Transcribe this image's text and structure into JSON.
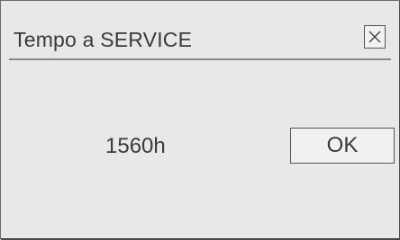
{
  "dialog": {
    "title": "Tempo a SERVICE",
    "close_icon": "close-icon",
    "value_text": "1560h",
    "ok_label": "OK"
  },
  "colors": {
    "background": "#e8e8e8",
    "text": "#3a3a3a",
    "border": "#555555"
  }
}
